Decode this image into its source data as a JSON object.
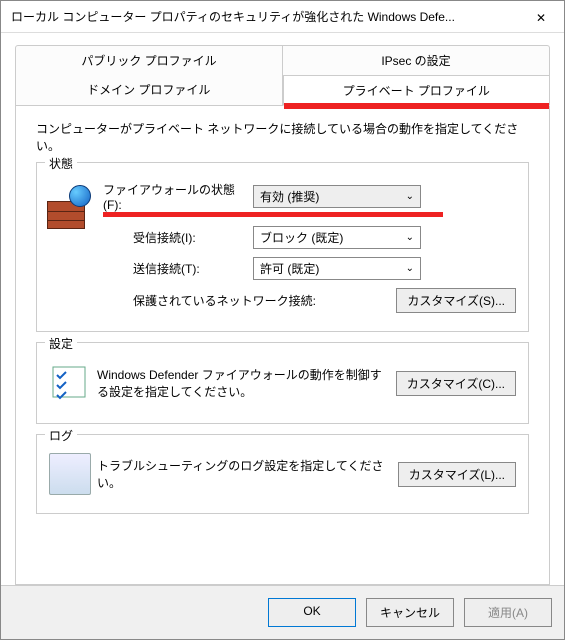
{
  "window": {
    "title": "ローカル コンピューター プロパティのセキュリティが強化された Windows Defe..."
  },
  "tabs": {
    "public": "パブリック プロファイル",
    "ipsec": "IPsec の設定",
    "domain": "ドメイン プロファイル",
    "private": "プライベート プロファイル"
  },
  "panel": {
    "desc": "コンピューターがプライベート ネットワークに接続している場合の動作を指定してください。"
  },
  "state": {
    "group": "状態",
    "firewall_label": "ファイアウォールの状態(F):",
    "firewall_value": "有効 (推奨)",
    "inbound_label": "受信接続(I):",
    "inbound_value": "ブロック (既定)",
    "outbound_label": "送信接続(T):",
    "outbound_value": "許可 (既定)",
    "protected_label": "保護されているネットワーク接続:",
    "customize_s": "カスタマイズ(S)..."
  },
  "settings": {
    "group": "設定",
    "desc": "Windows Defender ファイアウォールの動作を制御する設定を指定してください。",
    "customize_c": "カスタマイズ(C)..."
  },
  "log": {
    "group": "ログ",
    "desc": "トラブルシューティングのログ設定を指定してください。",
    "customize_l": "カスタマイズ(L)..."
  },
  "footer": {
    "ok": "OK",
    "cancel": "キャンセル",
    "apply": "適用(A)"
  }
}
